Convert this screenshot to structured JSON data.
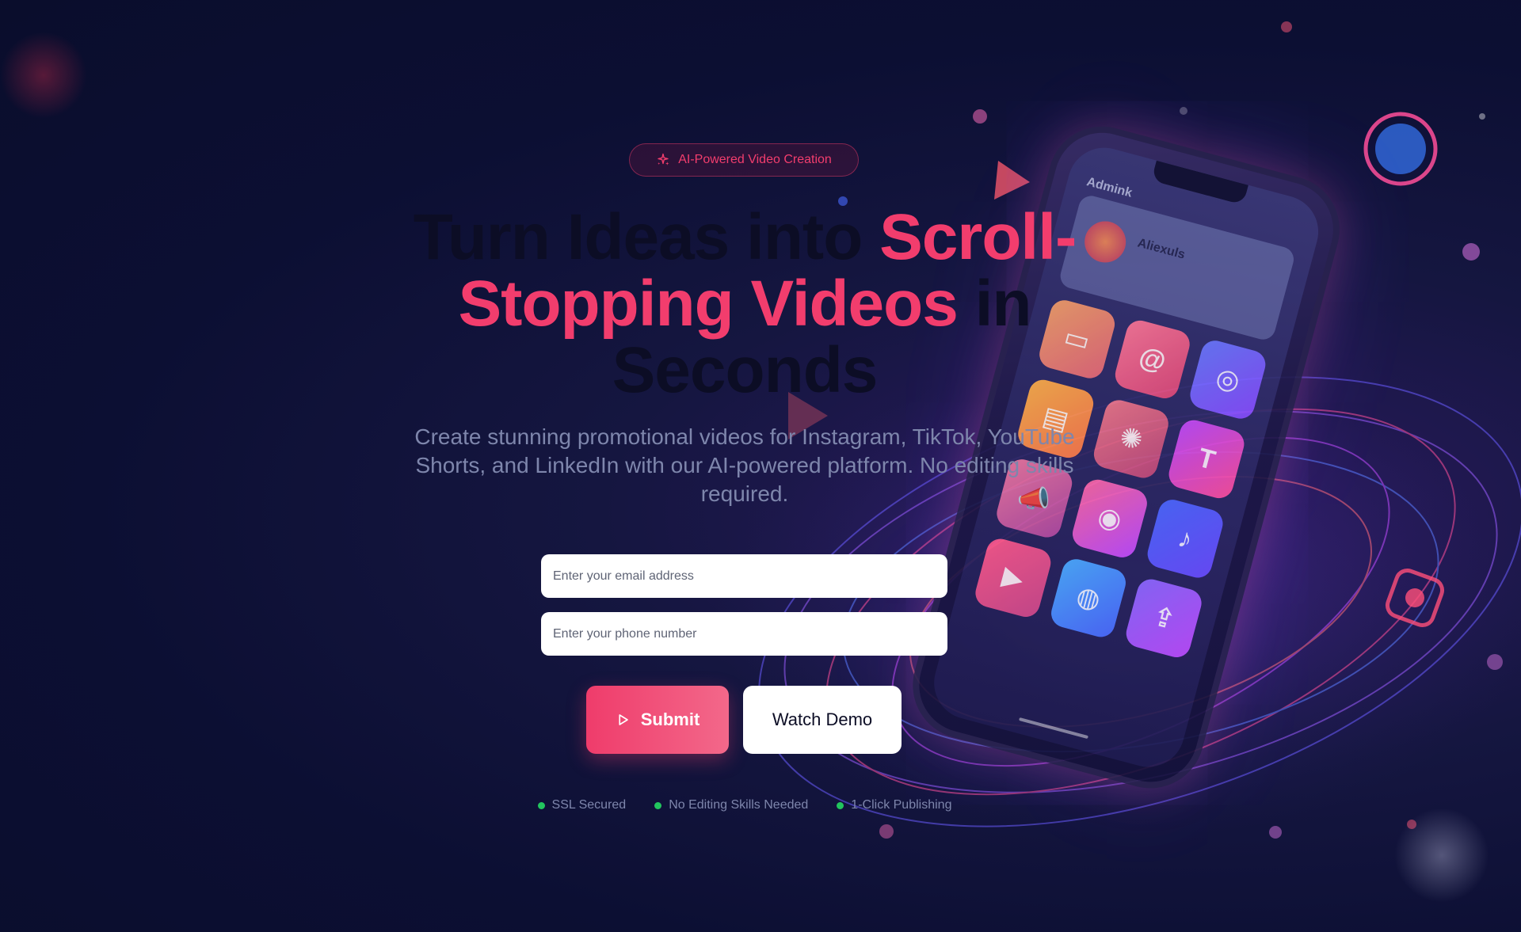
{
  "badge": {
    "icon": "sparkles-icon",
    "label": "AI-Powered Video Creation"
  },
  "headline": {
    "part1": "Turn Ideas into ",
    "accent1": "Scroll-",
    "accent2": "Stopping Videos",
    "part2": " in",
    "part3": "Seconds"
  },
  "subtext": "Create stunning promotional videos for Instagram, TikTok, YouTube Shorts, and LinkedIn with our AI-powered platform. No editing skills required.",
  "form": {
    "email_placeholder": "Enter your email address",
    "phone_placeholder": "Enter your phone number"
  },
  "buttons": {
    "submit_label": "Submit",
    "submit_icon": "play-icon",
    "demo_label": "Watch Demo"
  },
  "trust": [
    {
      "label": "SSL Secured"
    },
    {
      "label": "No Editing Skills Needed"
    },
    {
      "label": "1-Click Publishing"
    }
  ],
  "illustration": {
    "brand": "Admink",
    "user": "Aliexuls"
  },
  "colors": {
    "accent": "#f23d6d",
    "background": "#0c0f33",
    "muted_text": "#7e86ac",
    "status_green": "#22c55e"
  }
}
